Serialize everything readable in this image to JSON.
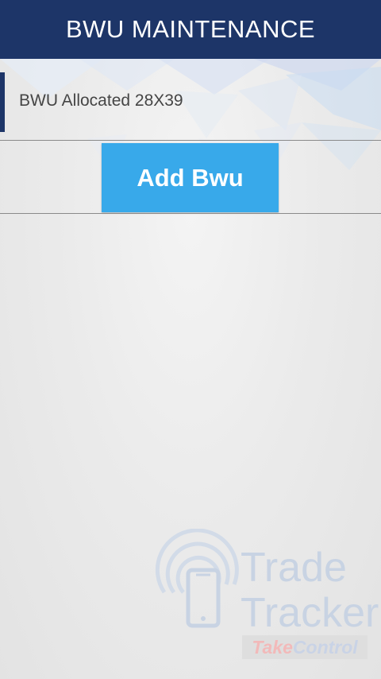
{
  "header": {
    "title": "BWU MAINTENANCE"
  },
  "bwu_row": {
    "label": "BWU Allocated 28X39"
  },
  "add_button": {
    "label": "Add Bwu"
  },
  "watermark": {
    "brand_line1": "Trade",
    "brand_line2": "Tracker",
    "tagline_part1": "Take",
    "tagline_part2": "Control"
  },
  "colors": {
    "header_bg": "#1d3568",
    "button_bg": "#38a9ea",
    "accent": "#1d3568"
  }
}
